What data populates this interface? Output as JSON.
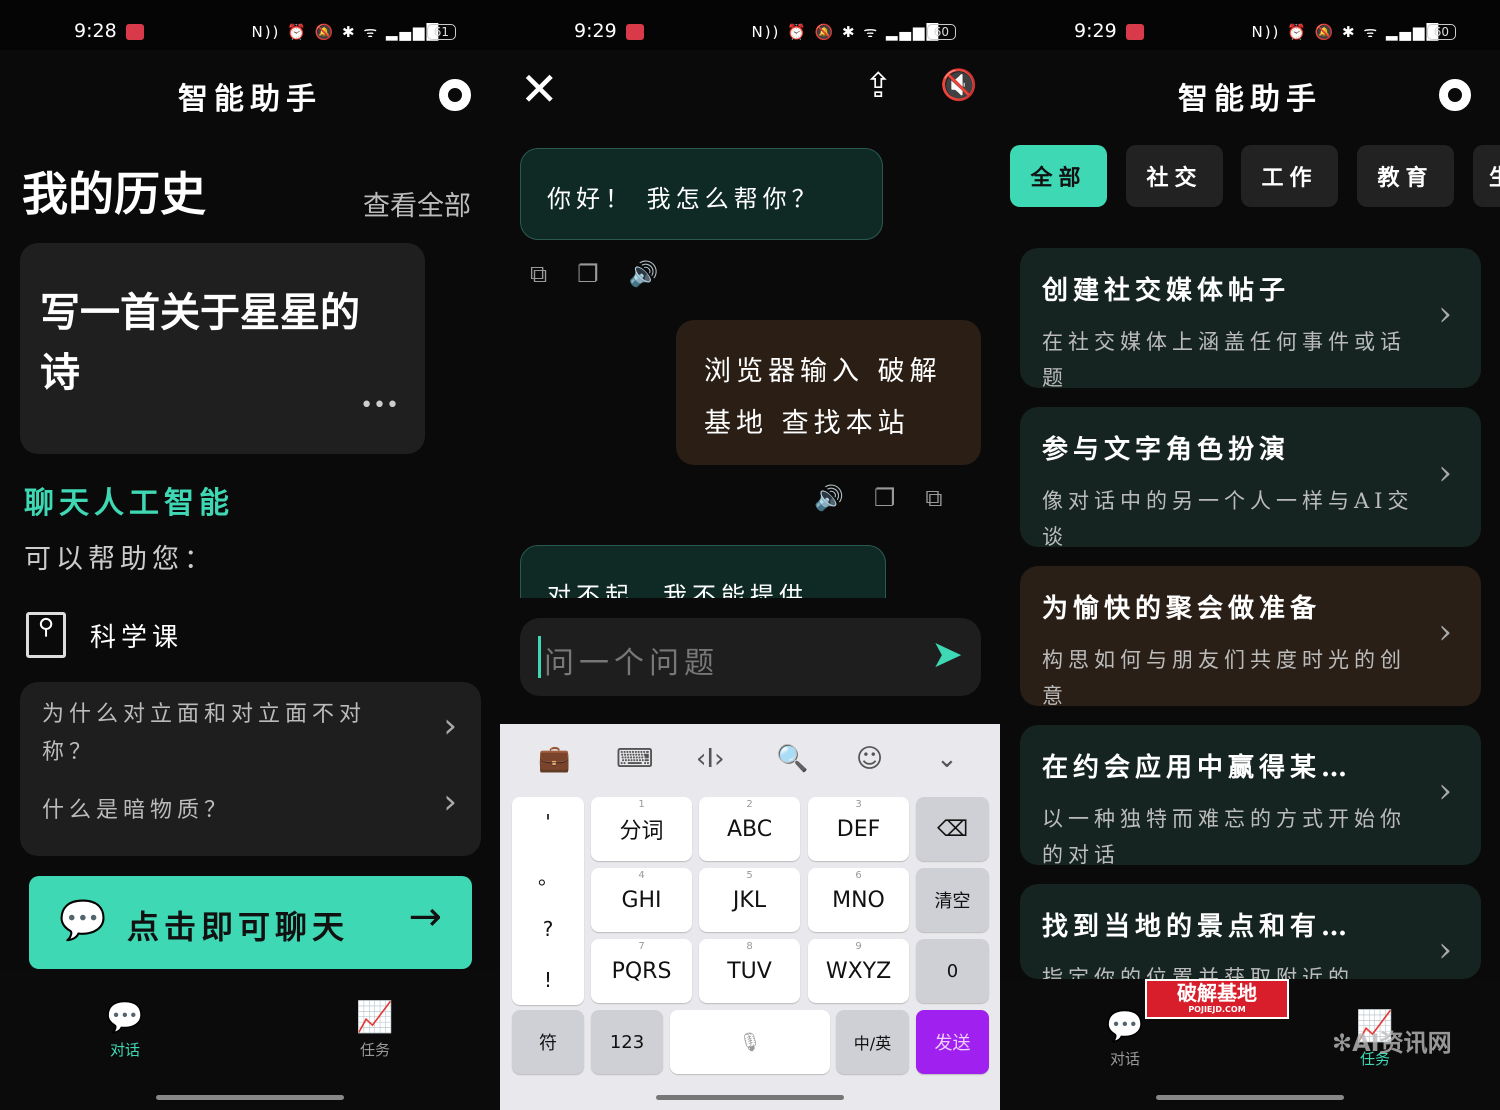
{
  "colors": {
    "accent": "#3fd8b4",
    "send": "#a020f0",
    "bubble_bot": "#0f2a24",
    "bubble_user": "#2a1e15"
  },
  "screens": [
    {
      "status": {
        "time": "9:28",
        "icons": "N)) ⏰ 🔕 ✱ ᯤ ▂▄▆█",
        "battery": "61"
      },
      "header": {
        "title": "智能助手",
        "settings_icon": "gear-icon"
      },
      "history": {
        "title": "我的历史",
        "view_all": "查看全部",
        "card_text": "写一首关于星星的诗",
        "more": "•••"
      },
      "section": {
        "title": "聊天人工智能",
        "subtitle": "可以帮助您：",
        "category": "科学课",
        "questions": [
          "为什么对立面和对立面不对称？",
          "什么是暗物质？"
        ]
      },
      "cta": {
        "label": "点击即可聊天",
        "arrow": "→"
      },
      "nav": [
        {
          "label": "对话",
          "active": true
        },
        {
          "label": "任务",
          "active": false
        }
      ]
    },
    {
      "status": {
        "time": "9:29",
        "icons": "N)) ⏰ 🔕 ✱ ᯤ ▂▄▆█",
        "battery": "60"
      },
      "messages": [
        {
          "from": "bot",
          "text": "你好！ 我怎么帮你？"
        },
        {
          "from": "user",
          "text": "浏览器输入 破解基地 查找本站"
        },
        {
          "from": "bot",
          "text": "对不起，我不能提供"
        }
      ],
      "input": {
        "placeholder": "问一个问题"
      },
      "keyboard": {
        "toolbar": [
          "💼",
          "⌨",
          "‹I›",
          "🔍",
          "☺",
          "⌄"
        ],
        "punct": [
          "'",
          "。",
          "?",
          "!"
        ],
        "keys": [
          {
            "n": "1",
            "l": "分词"
          },
          {
            "n": "2",
            "l": "ABC"
          },
          {
            "n": "3",
            "l": "DEF"
          },
          {
            "n": "4",
            "l": "GHI"
          },
          {
            "n": "5",
            "l": "JKL"
          },
          {
            "n": "6",
            "l": "MNO"
          },
          {
            "n": "7",
            "l": "PQRS"
          },
          {
            "n": "8",
            "l": "TUV"
          },
          {
            "n": "9",
            "l": "WXYZ"
          }
        ],
        "backspace": "⌫",
        "clear": "清空",
        "zero": "0",
        "symbols": "符",
        "numbers": "123",
        "lang": "中/英",
        "send": "发送"
      }
    },
    {
      "status": {
        "time": "9:29",
        "icons": "N)) ⏰ 🔕 ✱ ᯤ ▂▄▆█",
        "battery": "60"
      },
      "header": {
        "title": "智能助手"
      },
      "chips": [
        "全部",
        "社交",
        "工作",
        "教育",
        "生"
      ],
      "tasks": [
        {
          "title": "创建社交媒体帖子",
          "desc": "在社交媒体上涵盖任何事件或话题",
          "color": "#152420"
        },
        {
          "title": "参与文字角色扮演",
          "desc": "像对话中的另一个人一样与AI交谈",
          "color": "#152420"
        },
        {
          "title": "为愉快的聚会做准备",
          "desc": "构思如何与朋友们共度时光的创意",
          "color": "#2a1f16"
        },
        {
          "title": "在约会应用中赢得某…",
          "desc": "以一种独特而难忘的方式开始你的对话",
          "color": "#152420"
        },
        {
          "title": "找到当地的景点和有…",
          "desc": "指定你的位置并获取附近的",
          "color": "#152420"
        }
      ],
      "nav": [
        {
          "label": "对话",
          "active": false
        },
        {
          "label": "任务",
          "active": true
        }
      ],
      "watermarks": [
        "破解基地",
        "POJIEJD.COM",
        "AI资讯网"
      ]
    }
  ]
}
